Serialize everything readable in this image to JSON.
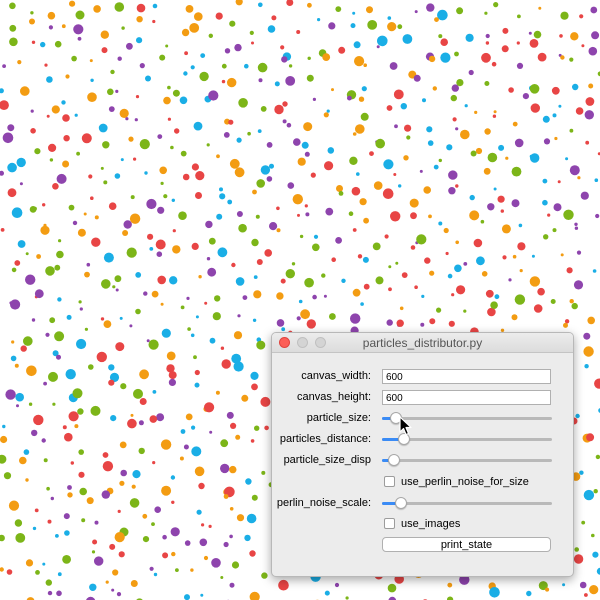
{
  "canvas": {
    "particle_colors": [
      "#e84545",
      "#f39c12",
      "#1aaee6",
      "#8e44ad",
      "#7cb518"
    ]
  },
  "window": {
    "title": "particles_distributor.py"
  },
  "controls": {
    "canvas_width": {
      "label": "canvas_width:",
      "value": "600"
    },
    "canvas_height": {
      "label": "canvas_height:",
      "value": "600"
    },
    "particle_size": {
      "label": "particle_size:",
      "level": 0.08
    },
    "particles_distance": {
      "label": "particles_distance:",
      "level": 0.13
    },
    "particle_size_disp": {
      "label": "particle_size_disp",
      "level": 0.07
    },
    "use_perlin_noise_for_size": {
      "label": "use_perlin_noise_for_size",
      "checked": false
    },
    "perlin_noise_scale": {
      "label": "perlin_noise_scale:",
      "level": 0.11
    },
    "use_images": {
      "label": "use_images",
      "checked": false
    },
    "print_state": {
      "label": "print_state"
    }
  },
  "cursor_icon": "arrow-pointer-icon"
}
